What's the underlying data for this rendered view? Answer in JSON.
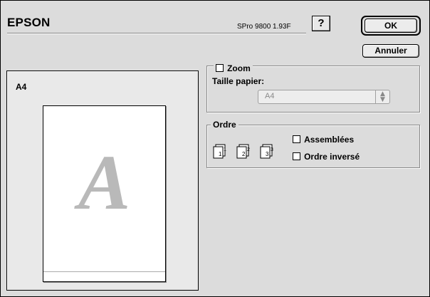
{
  "header": {
    "brand": "EPSON",
    "version": "SPro 9800 1.93F",
    "help_label": "?"
  },
  "buttons": {
    "ok": "OK",
    "cancel": "Annuler"
  },
  "preview": {
    "paper_name": "A4",
    "sample_letter": "A"
  },
  "zoom": {
    "label": "Zoom",
    "checked": false,
    "paper_size_label": "Taille papier:",
    "paper_size_value": "A4",
    "paper_size_enabled": false
  },
  "order": {
    "label": "Ordre",
    "page_icons": [
      "1",
      "2",
      "3"
    ],
    "collate_label": "Assemblées",
    "collate_checked": false,
    "reverse_label": "Ordre inversé",
    "reverse_checked": false
  },
  "colors": {
    "dialog_bg": "#dcdcdc",
    "preview_bg": "#e9e9e9",
    "letter_gray": "#b9b9b9"
  }
}
